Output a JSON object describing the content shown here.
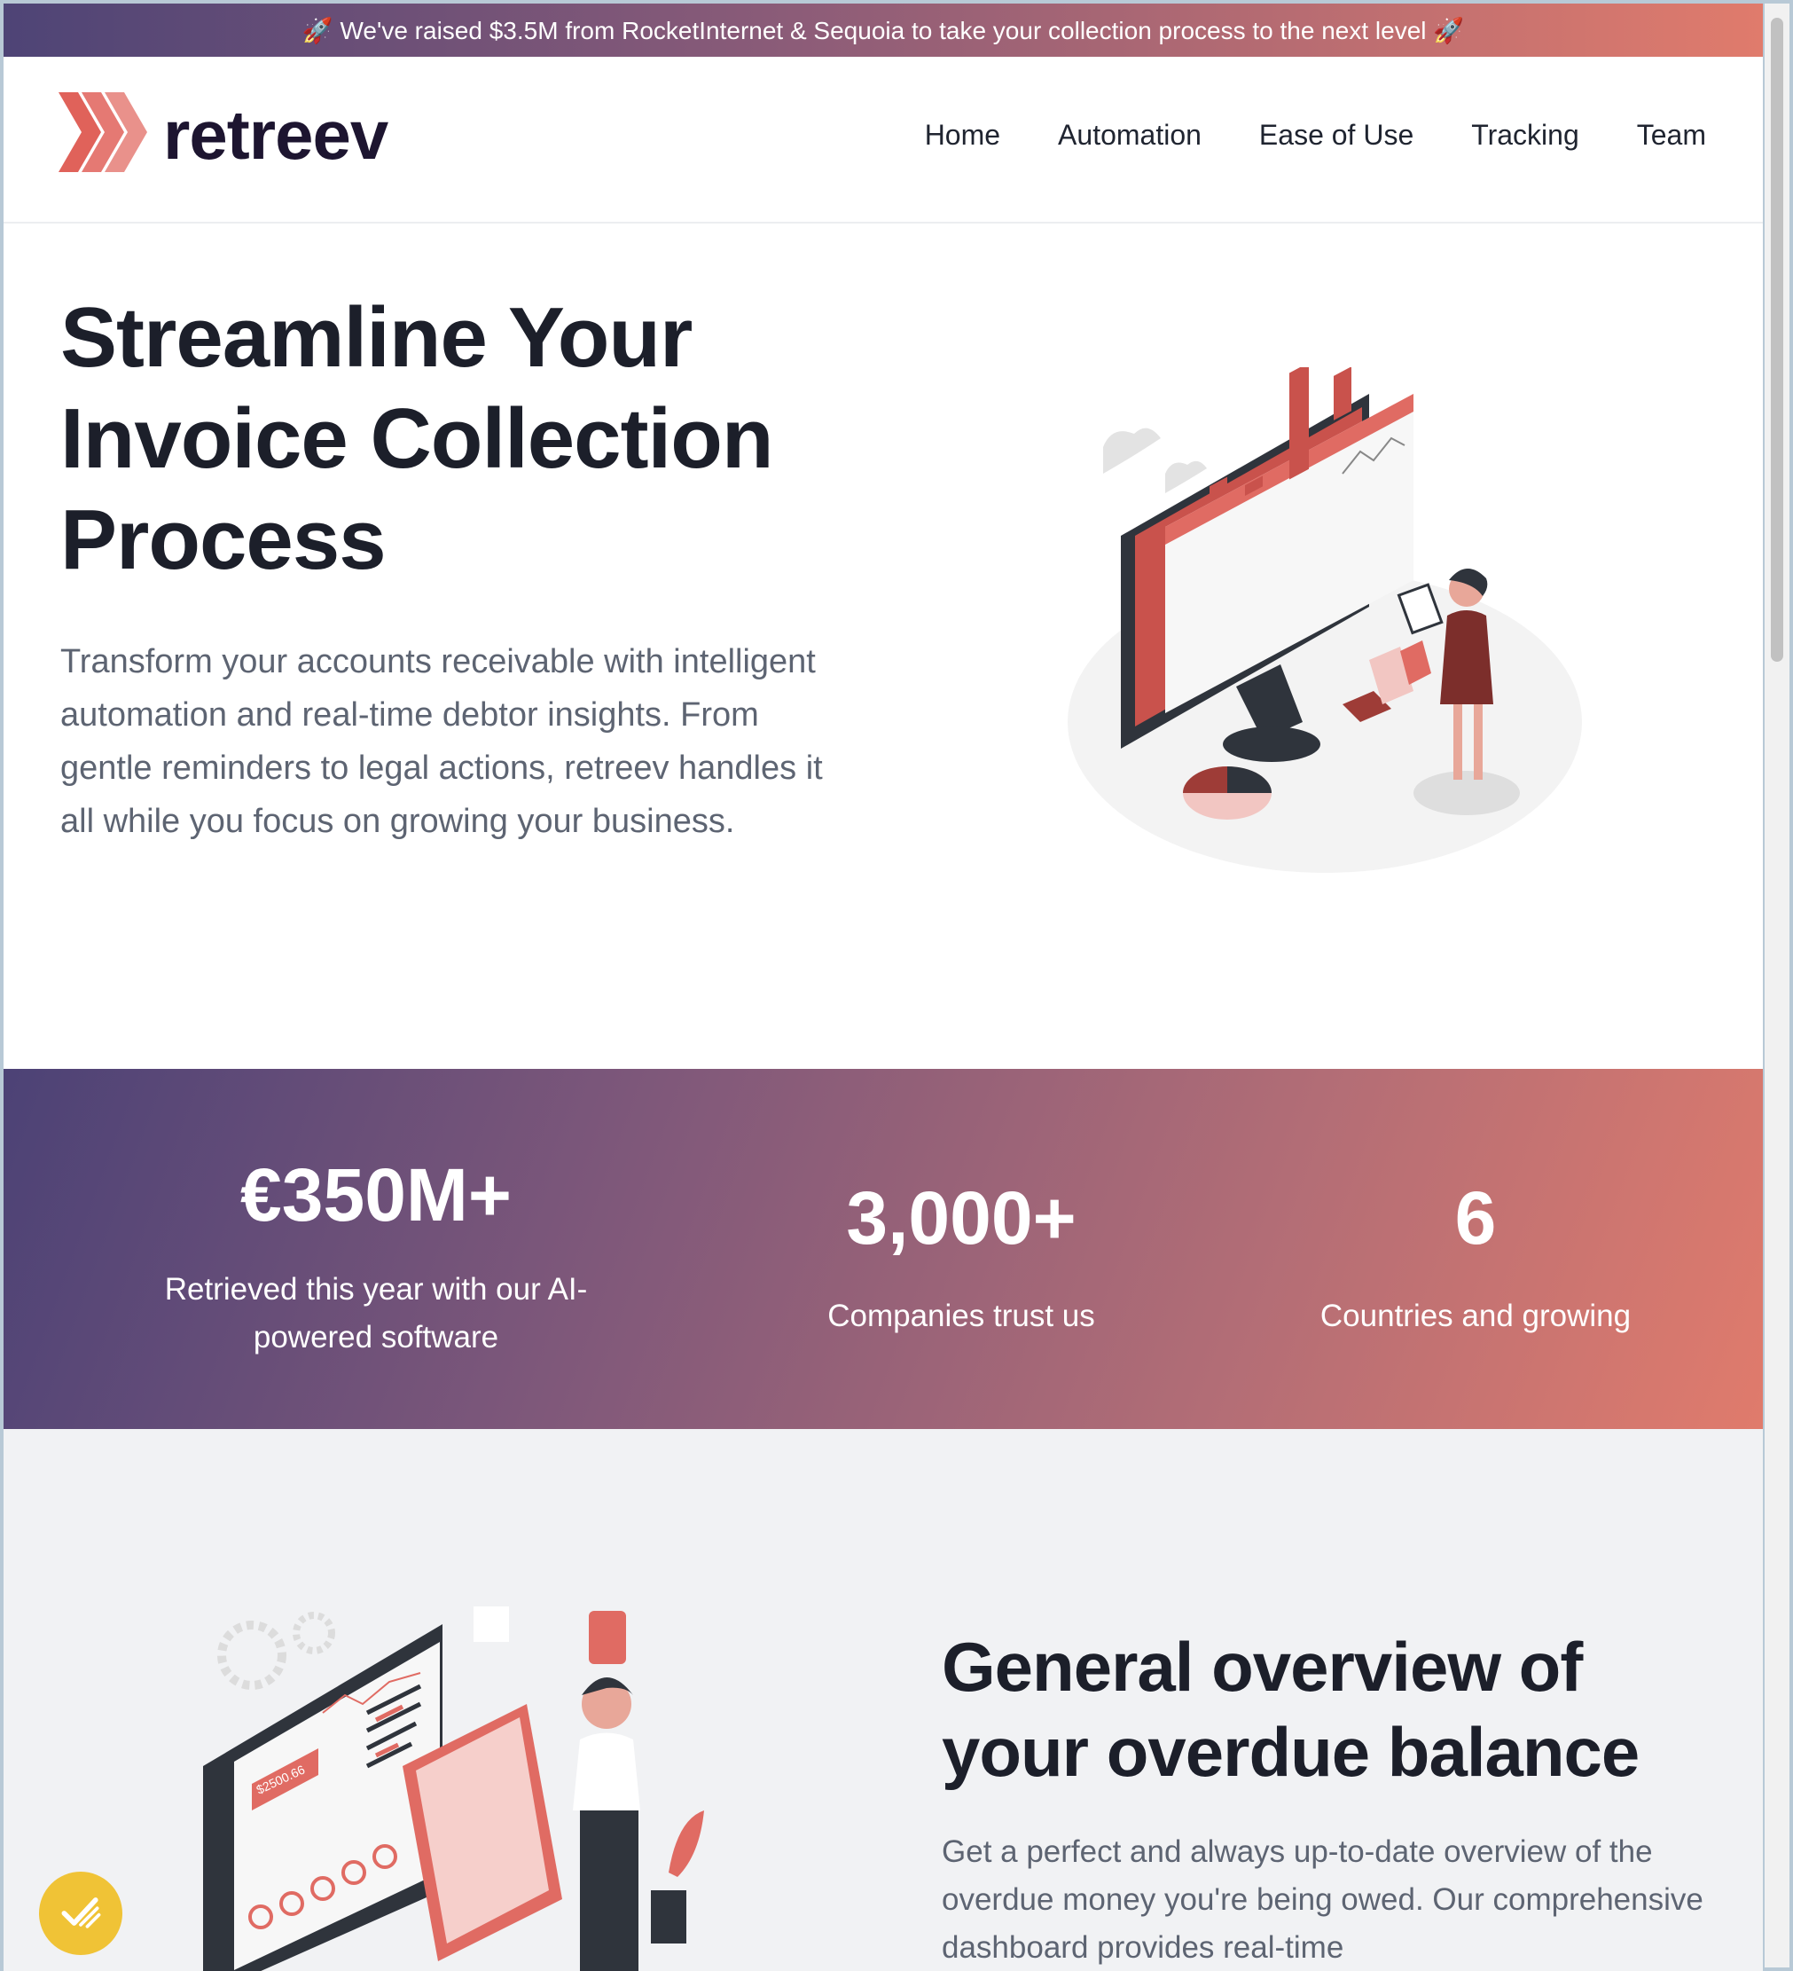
{
  "announcement": {
    "text": "🚀 We've raised $3.5M from RocketInternet & Sequoia to take your collection process to the next level 🚀"
  },
  "header": {
    "logo_text": "retreev",
    "nav": [
      "Home",
      "Automation",
      "Ease of Use",
      "Tracking",
      "Team"
    ]
  },
  "hero": {
    "title": "Streamline Your Invoice Collection Process",
    "description": "Transform your accounts receivable with intelligent automation and real-time debtor insights. From gentle reminders to legal actions, retreev handles it all while you focus on growing your business."
  },
  "stats": [
    {
      "value": "€350M+",
      "label": "Retrieved this year with our AI-powered software"
    },
    {
      "value": "3,000+",
      "label": "Companies trust us"
    },
    {
      "value": "6",
      "label": "Countries and growing"
    }
  ],
  "overview": {
    "title": "General overview of your overdue balance",
    "description": "Get a perfect and always up-to-date overview of the overdue money you're being owed. Our comprehensive dashboard provides real-time",
    "illustration_amount": "$2500.66"
  },
  "colors": {
    "gradient_start": "#4e4476",
    "gradient_end": "#e07b6c",
    "accent": "#e0625a",
    "chat_button": "#f0c336"
  },
  "icons": {
    "logo": "chevrons-icon",
    "chat": "check-chat-icon"
  }
}
